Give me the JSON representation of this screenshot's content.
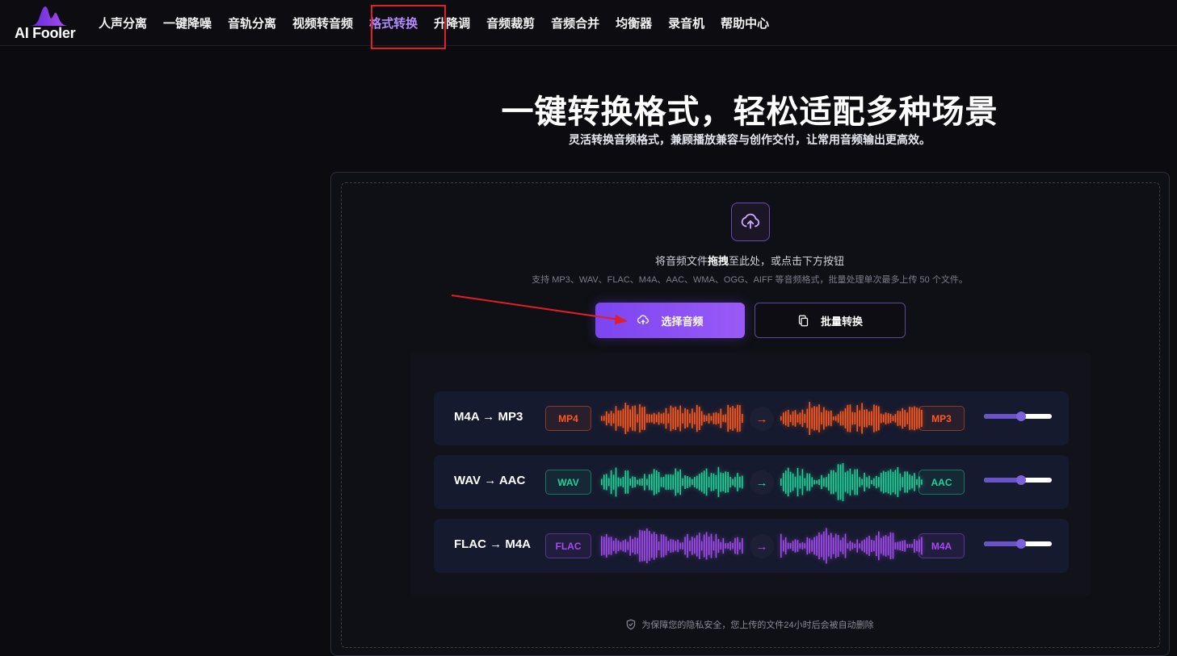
{
  "brand": {
    "name": "AI Fooler",
    "logo_icon": "soundwave-logo"
  },
  "nav": {
    "items": [
      {
        "label": "人声分离"
      },
      {
        "label": "一键降噪"
      },
      {
        "label": "音轨分离"
      },
      {
        "label": "视频转音频"
      },
      {
        "label": "格式转换",
        "active": true
      },
      {
        "label": "升降调"
      },
      {
        "label": "音频裁剪"
      },
      {
        "label": "音频合并"
      },
      {
        "label": "均衡器"
      },
      {
        "label": "录音机"
      },
      {
        "label": "帮助中心"
      }
    ]
  },
  "hero": {
    "title": "一键转换格式，轻松适配多种场景",
    "subtitle": "灵活转换音频格式，兼顾播放兼容与创作交付，让常用音频输出更高效。"
  },
  "upload": {
    "icon": "cloud-upload-icon",
    "hint_before": "将音频文件",
    "hint_bold": "拖拽",
    "hint_after": "至此处，或点击下方按钮",
    "formats_hint": "支持 MP3、WAV、FLAC、M4A、AAC、WMA、OGG、AIFF 等音频格式，批量处理单次最多上传 50 个文件。",
    "select_button": "选择音频",
    "batch_button": "批量转换"
  },
  "demo_rows": [
    {
      "label": "M4A → MP3",
      "from": "MP4",
      "to": "MP3",
      "color": "#ff5a1f",
      "slider_level": 0.55
    },
    {
      "label": "WAV → AAC",
      "from": "WAV",
      "to": "AAC",
      "color": "#1fd39a",
      "slider_level": 0.55
    },
    {
      "label": "FLAC → M4A",
      "from": "FLAC",
      "to": "M4A",
      "color": "#a44cf2",
      "slider_level": 0.55
    }
  ],
  "privacy": {
    "text": "为保障您的隐私安全，您上传的文件24小时后会被自动删除"
  },
  "colors": {
    "accent": "#8b4ff5",
    "background": "#0b0b10",
    "nav_active": "#b58cff",
    "highlight_box": "#e01f26"
  }
}
